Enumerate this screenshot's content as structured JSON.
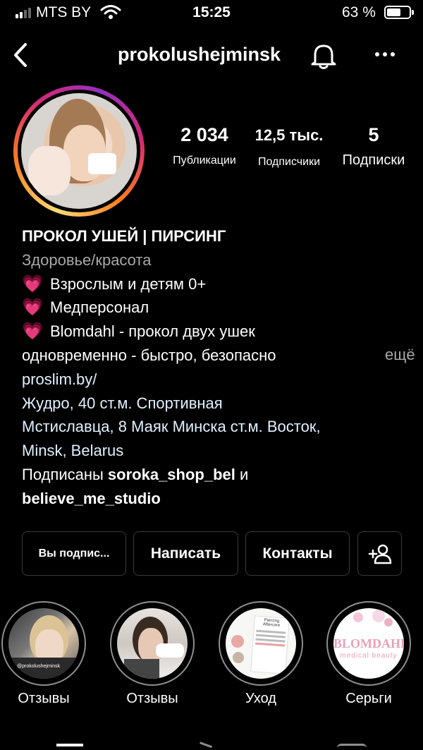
{
  "status_bar": {
    "carrier": "MTS BY",
    "time": "15:25",
    "battery_pct": "63 %",
    "battery_level": 0.63
  },
  "header": {
    "username": "prokolushejminsk",
    "back_icon": "chevron-left-icon",
    "bell_icon": "bell-icon",
    "more_icon": "more-horizontal-icon"
  },
  "stats": [
    {
      "value": "2 034",
      "label": "Публикации"
    },
    {
      "value": "12,5 тыс.",
      "label": "Подписчики"
    },
    {
      "value": "5",
      "label": "Подписки"
    }
  ],
  "bio": {
    "name": "ПРОКОЛ УШЕЙ | ПИРСИНГ",
    "category": "Здоровье/красота",
    "heart_emoji": "💗",
    "lines": [
      "Взрослым и детям 0+",
      "Медперсонал",
      "Blomdahl - прокол двух ушек"
    ],
    "line4": "одновременно - быстро, безопасно",
    "more": "ещё",
    "website": "proslim.by/",
    "address1": "Жудро, 40 ст.м. Спортивная",
    "address2": "Мстиславца, 8 Маяк Минска ст.м. Восток,",
    "address3": "Minsk, Belarus",
    "followed_prefix": "Подписаны ",
    "followed_user1": "soroka_shop_bel",
    "followed_and": " и",
    "followed_user2": "believe_me_studio"
  },
  "buttons": {
    "following": "Вы подпис...",
    "message": "Написать",
    "contacts": "Контакты",
    "add_user_icon": "add-person-icon"
  },
  "highlights": [
    {
      "label": "Отзывы"
    },
    {
      "label": "Отзывы"
    },
    {
      "label": "Уход"
    },
    {
      "label": "Серьги"
    }
  ],
  "highlight_texts": {
    "card_title": "Piercing Aftercare",
    "brand": "BLOMDAHL",
    "brand_sub": "medical beauty",
    "tag": "@prokolushejminsk"
  },
  "colors": {
    "background": "#000000",
    "muted": "#a8a8a8",
    "link": "#e0f1ff",
    "heart": "#f06ba7",
    "border": "#3a3a3a"
  }
}
